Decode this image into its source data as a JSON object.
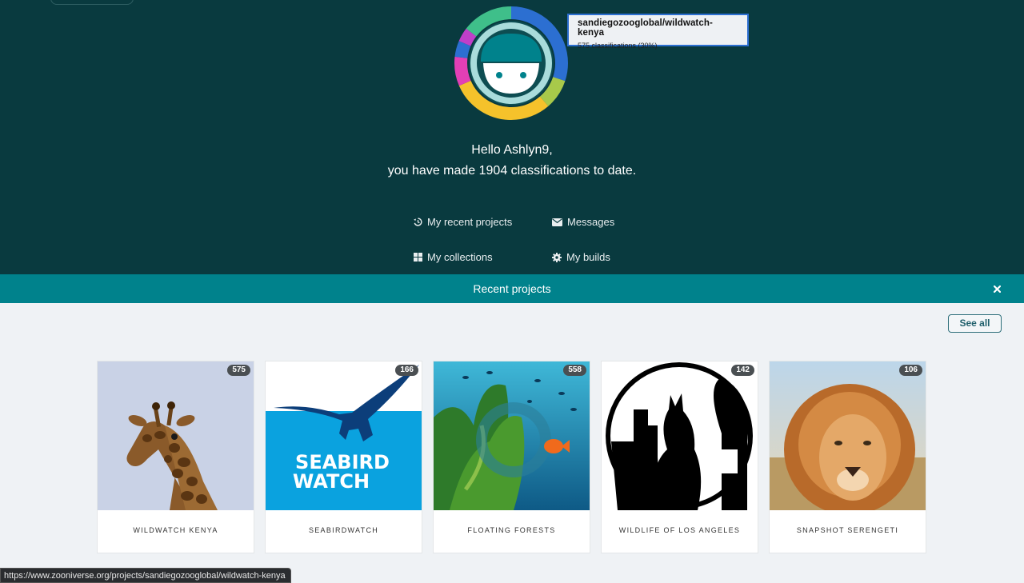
{
  "tooltip": {
    "project": "sandiegozooglobal/wildwatch-kenya",
    "detail": "575 classifications (30%)"
  },
  "greeting": {
    "line1": "Hello Ashlyn9,",
    "line2": "you have made 1904 classifications to date."
  },
  "nav": {
    "recent": "My recent projects",
    "messages": "Messages",
    "collections": "My collections",
    "builds": "My builds"
  },
  "recent_bar": {
    "title": "Recent projects"
  },
  "see_all": "See all",
  "projects": [
    {
      "name": "WILDWATCH KENYA",
      "count": "575"
    },
    {
      "name": "SEABIRDWATCH",
      "count": "166"
    },
    {
      "name": "FLOATING FORESTS",
      "count": "558"
    },
    {
      "name": "WILDLIFE OF LOS ANGELES",
      "count": "142"
    },
    {
      "name": "SNAPSHOT SERENGETI",
      "count": "106"
    }
  ],
  "seabird_logo": {
    "line1": "SEABIRD",
    "line2": "WATCH"
  },
  "status_url": "https://www.zooniverse.org/projects/sandiegozooglobal/wildwatch-kenya",
  "colors": {
    "hero": "#093a3f",
    "accent_bar": "#00828c",
    "ring_blue": "#2c6fd1",
    "ring_green": "#a8c94a",
    "ring_yellow": "#f5c22b",
    "ring_magenta": "#e23fb5",
    "ring_teal": "#3fbf8a"
  },
  "icons": [
    "history-icon",
    "envelope-icon",
    "grid-icon",
    "gear-icon",
    "close-icon"
  ]
}
